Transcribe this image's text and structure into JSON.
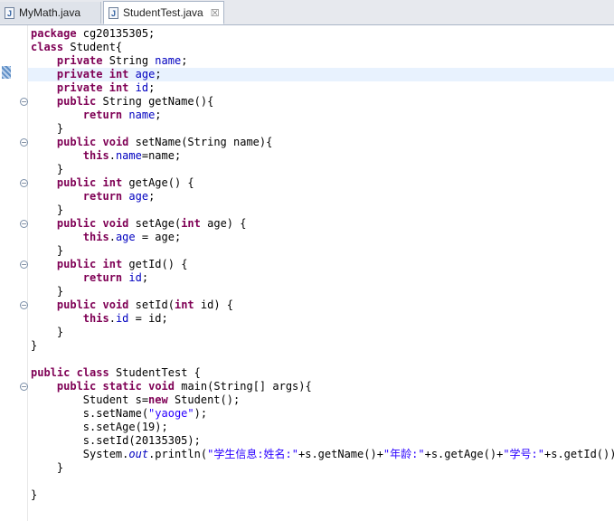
{
  "tabs": [
    {
      "label": "MyMath.java",
      "icon": "java-file-icon",
      "active": false
    },
    {
      "label": "StudentTest.java",
      "icon": "java-file-icon",
      "active": true,
      "close": "☒"
    }
  ],
  "editor": {
    "current_line": 4,
    "fold_marker": "⊖",
    "lines": [
      "package cg20135305;",
      "class Student{",
      "    private String name;",
      "    private int age;",
      "    private int id;",
      "    public String getName(){",
      "        return name;",
      "    }",
      "    public void setName(String name){",
      "        this.name=name;",
      "    }",
      "    public int getAge() {",
      "        return age;",
      "    }",
      "    public void setAge(int age) {",
      "        this.age = age;",
      "    }",
      "    public int getId() {",
      "        return id;",
      "    }",
      "    public void setId(int id) {",
      "        this.id = id;",
      "    }",
      "}",
      "",
      "public class StudentTest {",
      "    public static void main(String[] args){",
      "        Student s=new Student();",
      "        s.setName(\"yaoge\");",
      "        s.setAge(19);",
      "        s.setId(20135305);",
      "        System.out.println(\"学生信息:姓名:\"+s.getName()+\"年龄:\"+s.getAge()+\"学号:\"+s.getId());",
      "    }",
      "",
      "}"
    ],
    "fold_lines": [
      6,
      9,
      12,
      15,
      18,
      21,
      27
    ]
  },
  "colors": {
    "keyword": "#7f0055",
    "field": "#0000c0",
    "string": "#2a00ff",
    "current_line_bg": "#e8f2fe"
  }
}
